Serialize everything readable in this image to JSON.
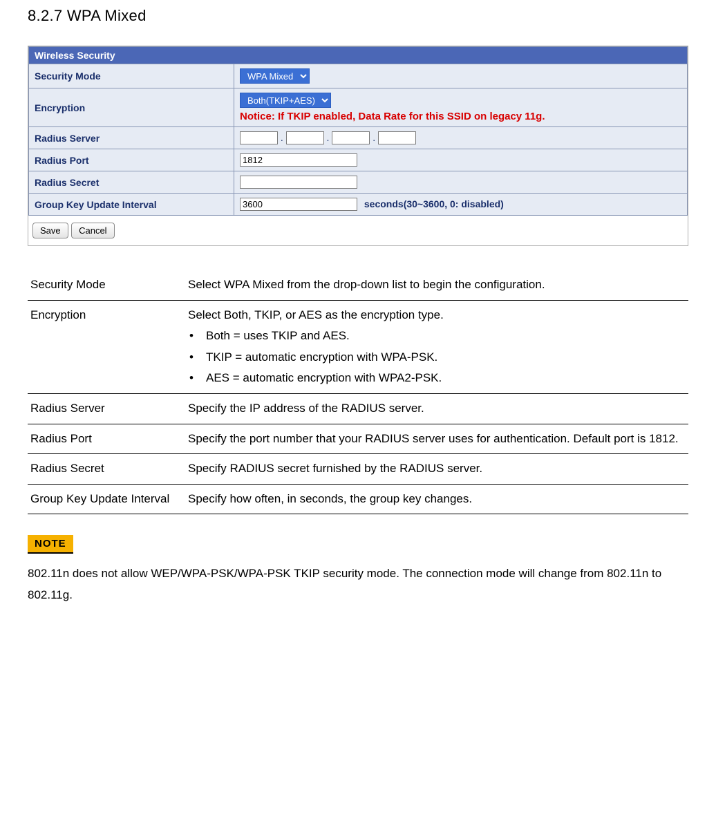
{
  "heading": "8.2.7 WPA Mixed",
  "panel": {
    "title": "Wireless Security",
    "rows": {
      "security_mode": {
        "label": "Security Mode",
        "value": "WPA Mixed"
      },
      "encryption": {
        "label": "Encryption",
        "value": "Both(TKIP+AES)",
        "notice": "Notice: If TKIP enabled, Data Rate for this SSID on legacy 11g."
      },
      "radius_server": {
        "label": "Radius Server",
        "oct1": "",
        "oct2": "",
        "oct3": "",
        "oct4": ""
      },
      "radius_port": {
        "label": "Radius Port",
        "value": "1812"
      },
      "radius_secret": {
        "label": "Radius Secret",
        "value": ""
      },
      "gkui": {
        "label": "Group Key Update Interval",
        "value": "3600",
        "suffix": "seconds(30~3600, 0: disabled)"
      }
    },
    "buttons": {
      "save": "Save",
      "cancel": "Cancel"
    }
  },
  "desc": {
    "security_mode": {
      "term": "Security Mode",
      "text": "Select WPA Mixed from the drop-down list to begin the configuration."
    },
    "encryption": {
      "term": "Encryption",
      "intro": "Select Both, TKIP, or AES as the encryption type.",
      "b1": "Both = uses TKIP and AES.",
      "b2": "TKIP = automatic encryption with WPA-PSK.",
      "b3": "AES = automatic encryption with WPA2-PSK."
    },
    "radius_server": {
      "term": "Radius Server",
      "text": "Specify the IP address of the RADIUS server."
    },
    "radius_port": {
      "term": "Radius Port",
      "text": "Specify the port number that your RADIUS server uses for authentication. Default port is 1812."
    },
    "radius_secret": {
      "term": "Radius Secret",
      "text": "Specify RADIUS secret furnished by the RADIUS server."
    },
    "gkui": {
      "term": "Group Key Update Interval",
      "text": "Specify how often, in seconds, the group key changes."
    }
  },
  "note": {
    "badge": "NOTE",
    "text": "802.11n does not allow WEP/WPA-PSK/WPA-PSK TKIP security mode. The connection mode will change from 802.11n to 802.11g."
  }
}
